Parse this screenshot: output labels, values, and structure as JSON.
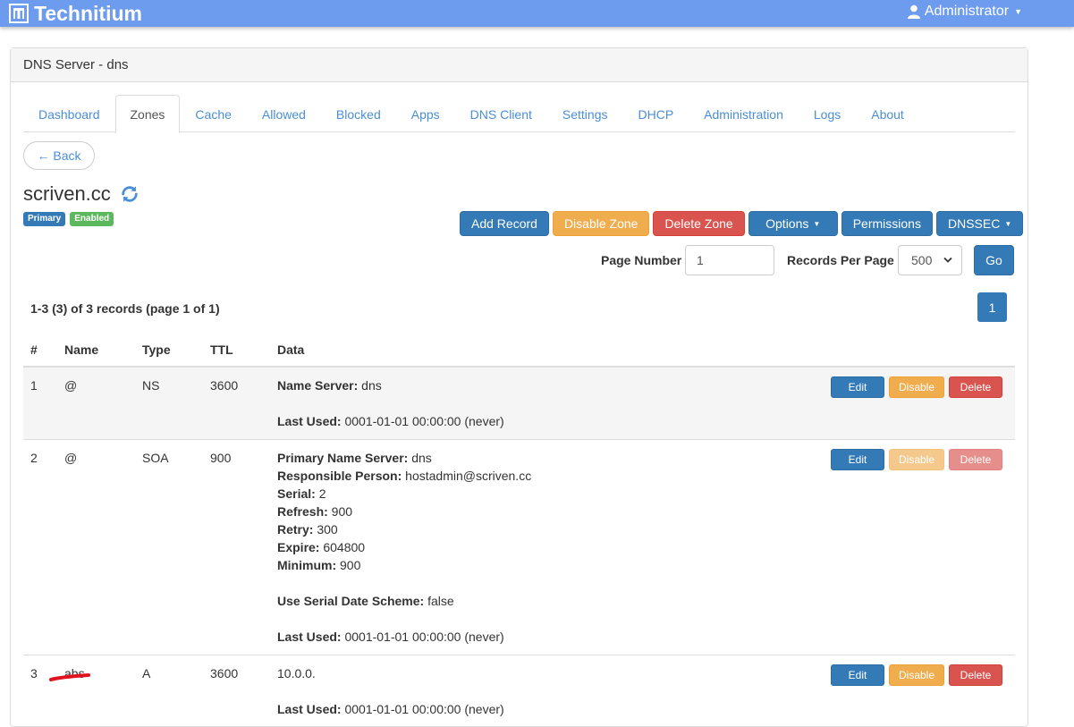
{
  "app": {
    "brand": "Technitium",
    "user": "Administrator"
  },
  "panel": {
    "title": "DNS Server - dns"
  },
  "tabs": [
    "Dashboard",
    "Zones",
    "Cache",
    "Allowed",
    "Blocked",
    "Apps",
    "DNS Client",
    "Settings",
    "DHCP",
    "Administration",
    "Logs",
    "About"
  ],
  "active_tab": "Zones",
  "back_label": "← Back",
  "zone": {
    "name": "scriven.cc",
    "badge_type": "Primary",
    "badge_status": "Enabled"
  },
  "zone_actions": {
    "add_record": "Add Record",
    "disable_zone": "Disable Zone",
    "delete_zone": "Delete Zone",
    "options": "Options",
    "permissions": "Permissions",
    "dnssec": "DNSSEC"
  },
  "pager": {
    "page_number_label": "Page Number",
    "page_number_value": "1",
    "records_per_page_label": "Records Per Page",
    "records_per_page_value": "500",
    "go_label": "Go",
    "summary": "1-3 (3) of 3 records (page 1 of 1)",
    "current_page": "1"
  },
  "table": {
    "headers": [
      "#",
      "Name",
      "Type",
      "TTL",
      "Data"
    ],
    "actions": {
      "edit": "Edit",
      "disable": "Disable",
      "delete": "Delete"
    },
    "rows": [
      {
        "index": "1",
        "name": "@",
        "type": "NS",
        "ttl": "3600",
        "fields": [
          {
            "label": "Name Server:",
            "value": " dns"
          }
        ],
        "extra": [],
        "last_used_label": "Last Used:",
        "last_used_value": " 0001-01-01 00:00:00 (never)"
      },
      {
        "index": "2",
        "name": "@",
        "type": "SOA",
        "ttl": "900",
        "fields": [
          {
            "label": "Primary Name Server:",
            "value": " dns"
          },
          {
            "label": "Responsible Person:",
            "value": " hostadmin@scriven.cc"
          },
          {
            "label": "Serial:",
            "value": " 2"
          },
          {
            "label": "Refresh:",
            "value": " 900"
          },
          {
            "label": "Retry:",
            "value": " 300"
          },
          {
            "label": "Expire:",
            "value": " 604800"
          },
          {
            "label": "Minimum:",
            "value": " 900"
          }
        ],
        "extra": [
          {
            "label": "Use Serial Date Scheme:",
            "value": " false"
          }
        ],
        "last_used_label": "Last Used:",
        "last_used_value": " 0001-01-01 00:00:00 (never)"
      },
      {
        "index": "3",
        "name": "abs",
        "type": "A",
        "ttl": "3600",
        "plain": "10.0.0.",
        "last_used_label": "Last Used:",
        "last_used_value": " 0001-01-01 00:00:00 (never)"
      }
    ]
  },
  "colors": {
    "topbar": "#6d9cee",
    "primary": "#337ab7",
    "warning": "#f0ad4e",
    "danger": "#d9534f",
    "success": "#5cb85c",
    "link": "#4a8ed6",
    "annotation": "#e0141e"
  }
}
